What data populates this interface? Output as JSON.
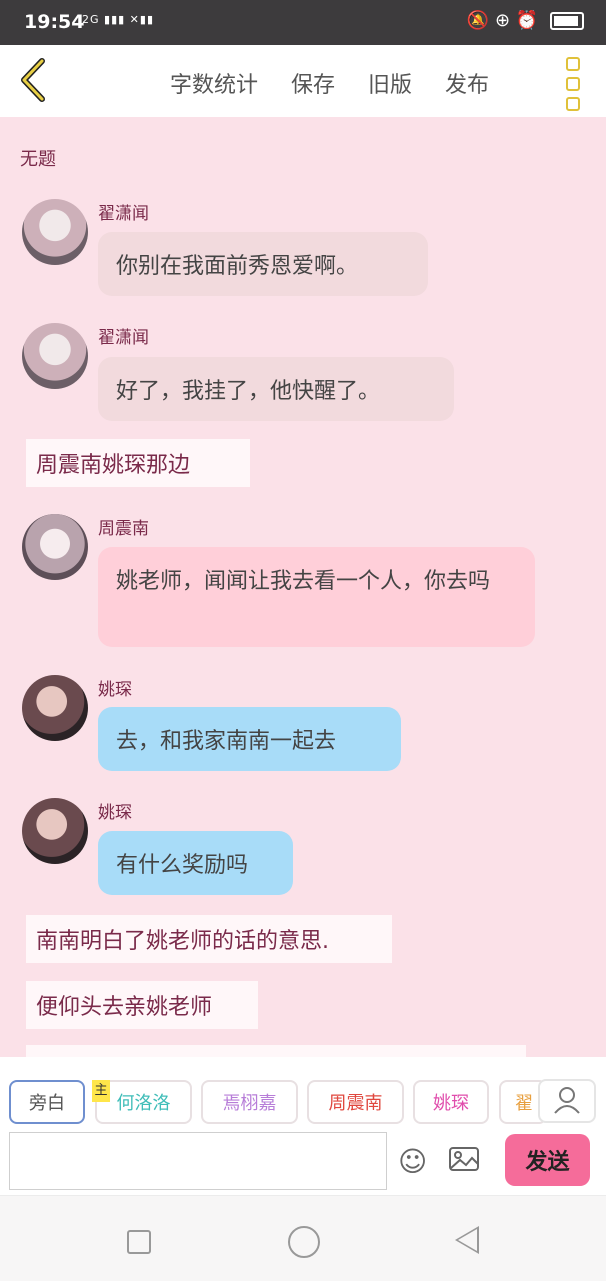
{
  "status_bar": {
    "time": "19:54",
    "signal": "2G ▮▮▮ ✕▮▮",
    "right_icons": "🔕 ⊕ ⏰"
  },
  "header": {
    "menu": [
      "字数统计",
      "保存",
      "旧版",
      "发布"
    ]
  },
  "chat": {
    "title": "无题",
    "messages": [
      {
        "name": "翟潇闻",
        "text": "你别在我面前秀恩爱啊。"
      },
      {
        "name": "翟潇闻",
        "text": "好了，我挂了，他快醒了。"
      },
      {
        "narration": "周震南姚琛那边"
      },
      {
        "name": "周震南",
        "text": "姚老师，闻闻让我去看一个人，你去吗"
      },
      {
        "name": "姚琛",
        "text": "去，和我家南南一起去"
      },
      {
        "name": "姚琛",
        "text": "有什么奖励吗"
      },
      {
        "narration": "南南明白了姚老师的话的意思."
      },
      {
        "narration": "便仰头去亲姚老师"
      }
    ]
  },
  "tabs": {
    "items": [
      "旁白",
      "何洛洛",
      "焉栩嘉",
      "周震南",
      "姚琛",
      "翟"
    ],
    "main_badge": "主"
  },
  "composer": {
    "send_label": "发送"
  },
  "colors": {
    "background": "#fbe1e8",
    "bubble_beige": "#f2dadd",
    "bubble_pink": "#ffcfd9",
    "bubble_blue": "#a8dcf8",
    "send": "#f56c9a"
  }
}
